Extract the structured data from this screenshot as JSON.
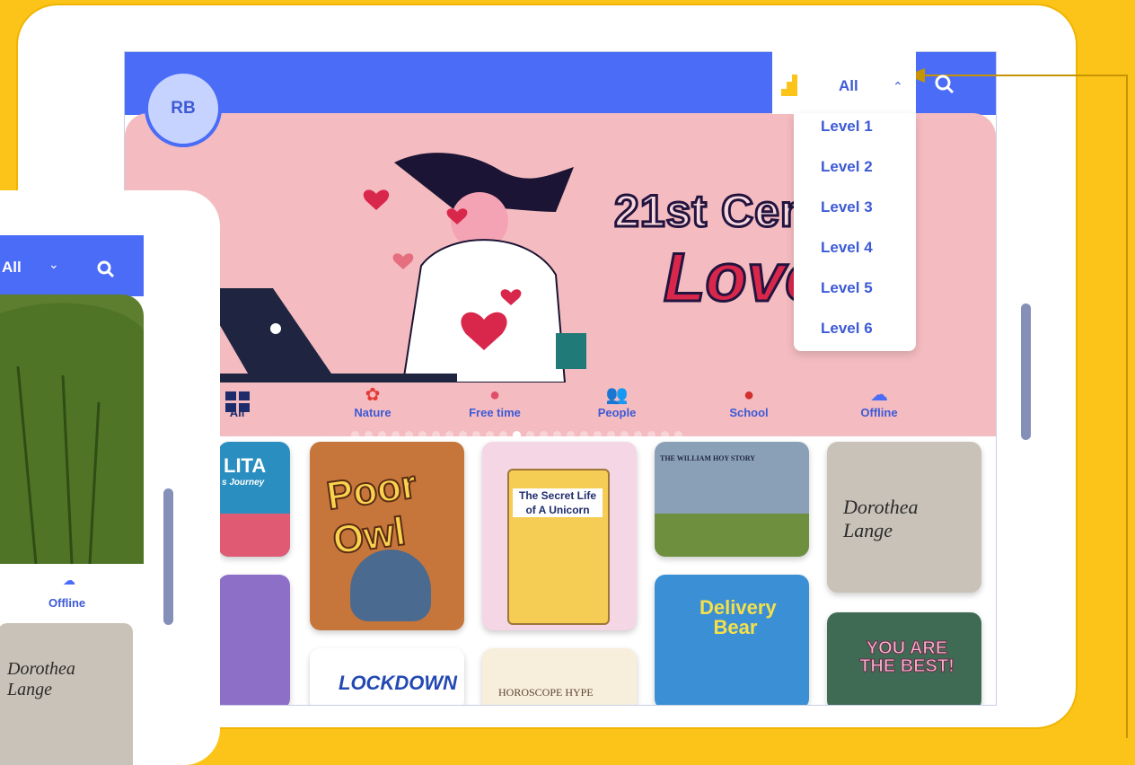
{
  "avatar": {
    "initials": "RB"
  },
  "level_filter": {
    "selected": "All",
    "options": [
      "Level 1",
      "Level 2",
      "Level 3",
      "Level 4",
      "Level 5",
      "Level 6"
    ]
  },
  "banner": {
    "title_line1": "21st Cent",
    "title_line2": "Love",
    "slide_count": 25,
    "active_slide": 12
  },
  "categories": [
    {
      "label": "All",
      "icon": "grid-icon"
    },
    {
      "label": "Nature",
      "icon": "flower-icon"
    },
    {
      "label": "Free time",
      "icon": "ball-icon"
    },
    {
      "label": "People",
      "icon": "people-icon"
    },
    {
      "label": "School",
      "icon": "apple-icon"
    },
    {
      "label": "Offline",
      "icon": "cloud-off-icon"
    }
  ],
  "books": [
    {
      "title": "LITA",
      "subtitle": "s Journey"
    },
    {
      "title": "Poor Owl"
    },
    {
      "title": "The Secret Life of A Unicorn"
    },
    {
      "title": "THE WILLIAM HOY STORY"
    },
    {
      "title": "Dorothea Lange"
    },
    {
      "title": "Delivery Bear"
    },
    {
      "title": "YOU ARE THE BEST!"
    },
    {
      "title": "LOCKDOWN"
    },
    {
      "title": "HOROSCOPE HYPE"
    }
  ],
  "back_device": {
    "filter_selected": "All",
    "category": "Offline",
    "book": "Dorothea Lange"
  },
  "colors": {
    "background": "#fcc419",
    "primary": "#4a6cf7",
    "accent_text": "#3d5ad6",
    "banner": "#f4bcc0"
  }
}
